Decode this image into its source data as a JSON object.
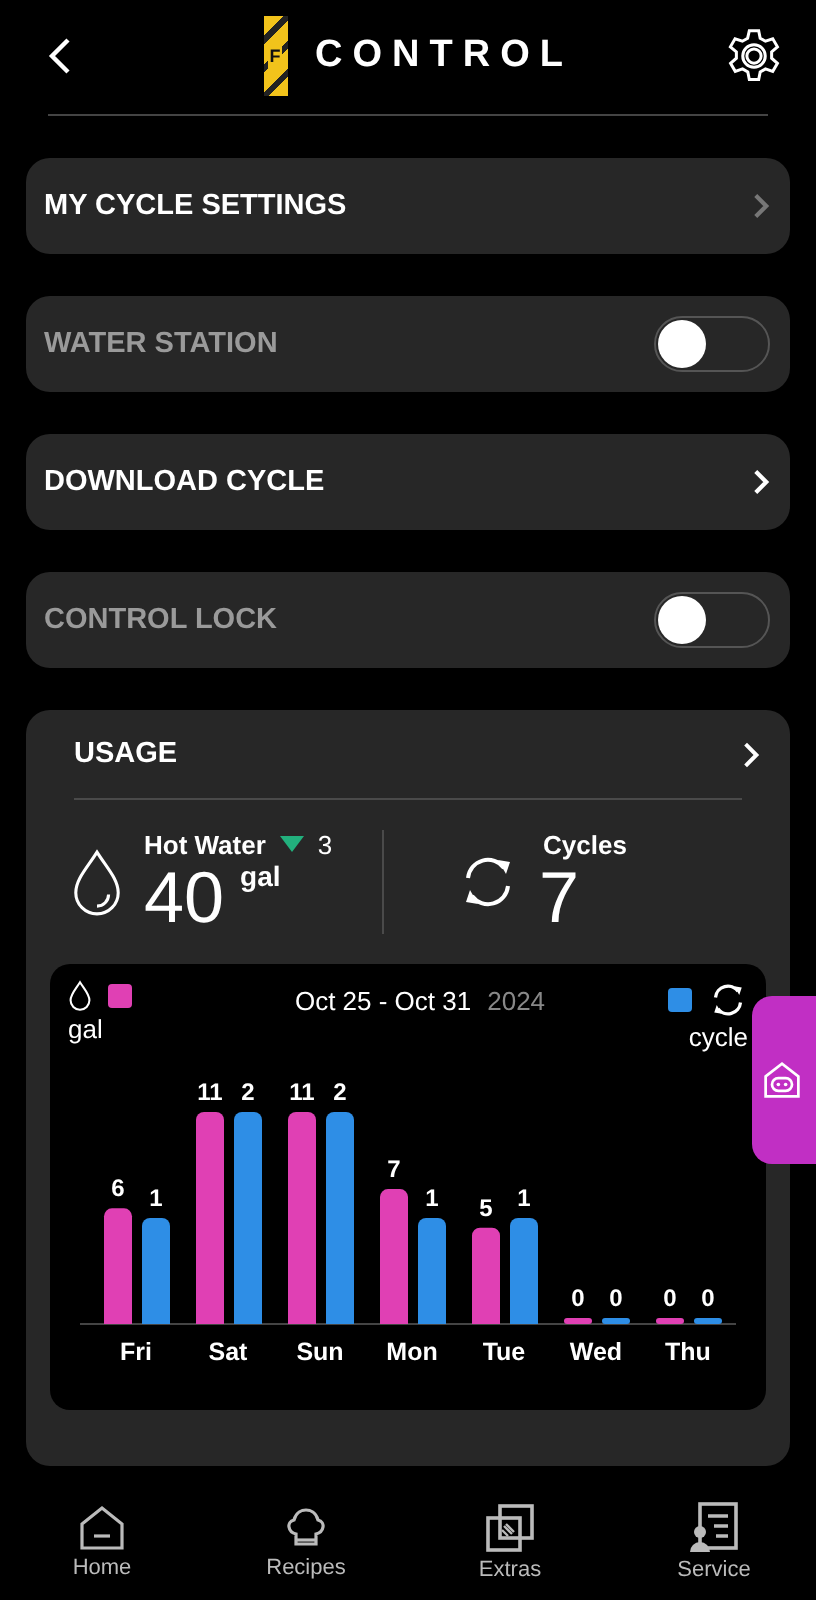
{
  "header": {
    "title": "CONTROL",
    "logo_letter": "F"
  },
  "rows": [
    {
      "kind": "link",
      "label": "MY CYCLE SETTINGS",
      "disabled": true
    },
    {
      "kind": "toggle",
      "label": "WATER STATION",
      "on": false
    },
    {
      "kind": "link",
      "label": "DOWNLOAD CYCLE",
      "disabled": false
    },
    {
      "kind": "toggle",
      "label": "CONTROL LOCK",
      "on": false
    }
  ],
  "usage": {
    "title": "USAGE",
    "hot_water": {
      "label": "Hot Water",
      "trend_down": true,
      "change": "3",
      "value": "40",
      "unit": "gal"
    },
    "cycles": {
      "label": "Cycles",
      "value": "7"
    },
    "date_range": "Oct 25 - Oct 31",
    "year": "2024",
    "gal_chart": {
      "chart_data": {
        "type": "bar",
        "categories": [
          "Fri",
          "Sat",
          "Sun",
          "Mon",
          "Tue",
          "Wed",
          "Thu"
        ],
        "data_labels": true,
        "series": [
          {
            "name": "gal",
            "color": "#e040b4",
            "values": [
              6,
              11,
              11,
              7,
              5,
              0,
              0
            ]
          }
        ]
      }
    },
    "cycle_chart": {
      "chart_data": {
        "type": "bar",
        "data_labels": true,
        "series": [
          {
            "name": "cycle",
            "color": "#2e8ee6",
            "values": [
              1,
              2,
              2,
              1,
              1,
              0,
              0
            ]
          }
        ]
      }
    }
  },
  "nav": [
    {
      "label": "Home"
    },
    {
      "label": "Recipes"
    },
    {
      "label": "Extras"
    },
    {
      "label": "Service"
    }
  ]
}
